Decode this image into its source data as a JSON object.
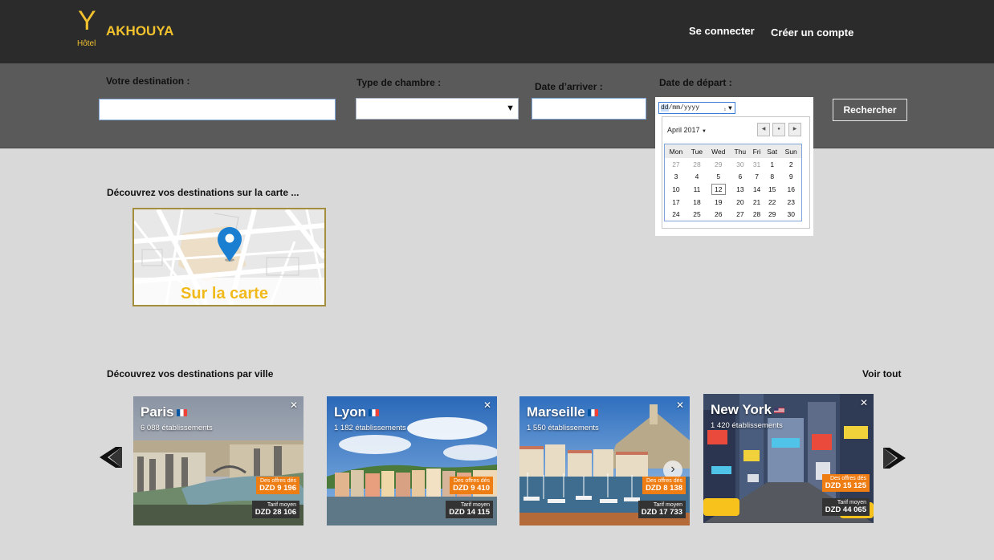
{
  "header": {
    "logo_letter": "Y",
    "logo_sub": "Hôtel",
    "brand": "AKHOUYA",
    "login": "Se connecter",
    "signup": "Créer un compte"
  },
  "search": {
    "destination_label": "Votre destination :",
    "room_type_label": "Type de chambre :",
    "arrival_label": "Date d’arriver :",
    "departure_label": "Date de départ :",
    "submit": "Rechercher",
    "departure_placeholder_day": "dd",
    "departure_placeholder_rest": "/mm/yyyy"
  },
  "datepicker": {
    "month": "April 2017",
    "weekdays": [
      "Mon",
      "Tue",
      "Wed",
      "Thu",
      "Fri",
      "Sat",
      "Sun"
    ],
    "weeks": [
      [
        "27",
        "28",
        "29",
        "30",
        "31",
        "1",
        "2"
      ],
      [
        "3",
        "4",
        "5",
        "6",
        "7",
        "8",
        "9"
      ],
      [
        "10",
        "11",
        "12",
        "13",
        "14",
        "15",
        "16"
      ],
      [
        "17",
        "18",
        "19",
        "20",
        "21",
        "22",
        "23"
      ],
      [
        "24",
        "25",
        "26",
        "27",
        "28",
        "29",
        "30"
      ]
    ],
    "today": "12"
  },
  "map_section": {
    "title": "Découvrez vos destinations sur la carte ...",
    "card_label": "Sur la carte"
  },
  "city_section": {
    "title": "Découvrez vos destinations par ville",
    "see_all": "Voir tout",
    "cities": [
      {
        "name": "Paris",
        "count": "6 088 établissements",
        "offer_label": "Des offres dés",
        "offer_price": "DZD 9 196",
        "avg_label": "Tarif moyen",
        "avg_price": "DZD 28 106",
        "flag": "fr"
      },
      {
        "name": "Lyon",
        "count": "1 182 établissements",
        "offer_label": "Des offres dés",
        "offer_price": "DZD 9 410",
        "avg_label": "Tarif moyen",
        "avg_price": "DZD 14 115",
        "flag": "fr"
      },
      {
        "name": "Marseille",
        "count": "1 550 établissements",
        "offer_label": "Des offres dés",
        "offer_price": "DZD 8 138",
        "avg_label": "Tarif moyen",
        "avg_price": "DZD 17 733",
        "flag": "fr"
      },
      {
        "name": "New York",
        "count": "1 420 établissements",
        "offer_label": "Des offres dés",
        "offer_price": "DZD 15 125",
        "avg_label": "Tarif moyen",
        "avg_price": "DZD 44 065",
        "flag": "us"
      }
    ]
  },
  "colors": {
    "accent": "#f2c22e",
    "header_bg": "#2b2b2b",
    "search_bg": "#5a5a5a",
    "page_bg": "#d9d9d9",
    "offer_orange": "#ee7d13"
  }
}
